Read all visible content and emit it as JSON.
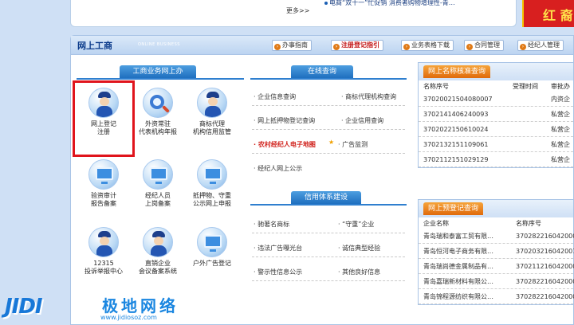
{
  "top": {
    "more_label": "更多>>",
    "news_item": "电商“双十一”忙促销 消费者购物增理性-青…",
    "promo_text": "红 裔"
  },
  "panel": {
    "title": "网上工商",
    "subtitle": "ONLINE BUSINESS",
    "quick_links": [
      {
        "label": "办事指南",
        "hot": false
      },
      {
        "label": "注册登记指引",
        "hot": true
      },
      {
        "label": "业务表格下载",
        "hot": false
      },
      {
        "label": "合同管理",
        "hot": false
      },
      {
        "label": "经纪人管理",
        "hot": false
      }
    ]
  },
  "services": {
    "tab": "工商业务网上办",
    "items": [
      {
        "label_1": "网上登记",
        "label_2": "注册",
        "icon": "officer-icon"
      },
      {
        "label_1": "外资常驻",
        "label_2": "代表机构年报",
        "icon": "magnifier-icon"
      },
      {
        "label_1": "商标代理",
        "label_2": "机构信用监管",
        "icon": "officer-icon"
      },
      {
        "label_1": "验资审计",
        "label_2": "报告备案",
        "icon": "monitor-icon"
      },
      {
        "label_1": "经纪人员",
        "label_2": "上岗备案",
        "icon": "monitor-icon"
      },
      {
        "label_1": "抵押物、守重",
        "label_2": "公示网上申报",
        "icon": "monitor-icon"
      },
      {
        "label_1": "12315",
        "label_2": "投诉举报中心",
        "icon": "officer-icon"
      },
      {
        "label_1": "直销企业",
        "label_2": "会议备案系统",
        "icon": "officer-icon"
      },
      {
        "label_1": "户外广告登记",
        "label_2": "",
        "icon": "monitor-icon"
      }
    ]
  },
  "online_query": {
    "tab": "在线查询",
    "rows": [
      {
        "left": "· 企业信息查询",
        "right": "· 商标代理机构查询"
      },
      {
        "left": "· 网上抵押物登记查询",
        "right": "· 企业信用查询"
      },
      {
        "left": "· 农村经纪人电子地图",
        "right": "· 广告监测"
      },
      {
        "left": "· 经纪人网上公示",
        "right": ""
      }
    ]
  },
  "credit": {
    "tab": "信用体系建设",
    "rows": [
      {
        "left": "· 驰著名商标",
        "right": "· “守重”企业"
      },
      {
        "left": "· 违法广告曝光台",
        "right": "· 诚信典型经验"
      },
      {
        "left": "· 警示性信息公示",
        "right": "· 其他良好信息"
      }
    ]
  },
  "name_check": {
    "title": "网上名称核准查询",
    "cols": [
      "名称序号",
      "受理时间",
      "审批办"
    ],
    "rows": [
      {
        "id": "370200215040800​07",
        "time": "",
        "office": "内资企"
      },
      {
        "id": "3702141406240093",
        "time": "",
        "office": "私营企"
      },
      {
        "id": "3702022150610024",
        "time": "",
        "office": "私营企"
      },
      {
        "id": "3702132151109061",
        "time": "",
        "office": "私营企"
      },
      {
        "id": "3702112151029129",
        "time": "",
        "office": "私营企"
      }
    ]
  },
  "pre_register": {
    "title": "网上预登记查询",
    "cols": [
      "企业名称",
      "名称序号"
    ],
    "rows": [
      {
        "name": "青岛瑞和泰富工贸有限…",
        "id": "370282216042000"
      },
      {
        "name": "青岛恒河电子商务有限…",
        "id": "370203216042001"
      },
      {
        "name": "青岛瑞尚德金属制品有…",
        "id": "370211216042000"
      },
      {
        "name": "青岛嘉瑞新材料有限公…",
        "id": "370282216042000"
      },
      {
        "name": "青岛锦程源纺织有限公…",
        "id": "370282216042000"
      }
    ]
  },
  "watermark": {
    "logo": "JIDI",
    "cn": "极地网络",
    "url": "www.jidiosoz.com"
  },
  "colors": {
    "accent_blue": "#1f6fbf",
    "highlight_red": "#e0141c",
    "header_orange": "#e06a0c"
  }
}
